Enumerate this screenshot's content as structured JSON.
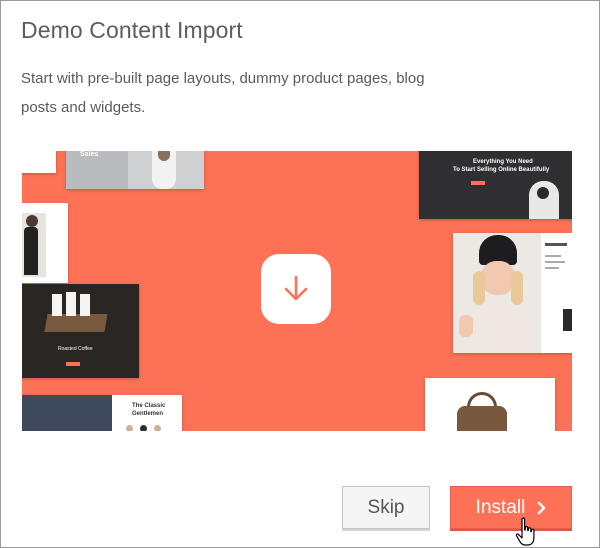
{
  "dialog": {
    "title": "Demo Content Import",
    "description": "Start with pre-built page layouts, dummy product pages, blog posts and widgets."
  },
  "preview": {
    "background_color": "#fd7156",
    "icon": "download-arrow-icon",
    "thumbnails": {
      "sales_text": "Sales",
      "hero_text_1": "Everything You Need",
      "hero_text_2": "To Start Selling Online Beautifully",
      "coffee_text": "Roasted Coffee",
      "gentleman_text_1": "The Classic",
      "gentleman_text_2": "Gentlemen"
    }
  },
  "actions": {
    "skip_label": "Skip",
    "install_label": "Install",
    "install_icon": "chevron-right-icon",
    "accent_color": "#fd7156"
  }
}
